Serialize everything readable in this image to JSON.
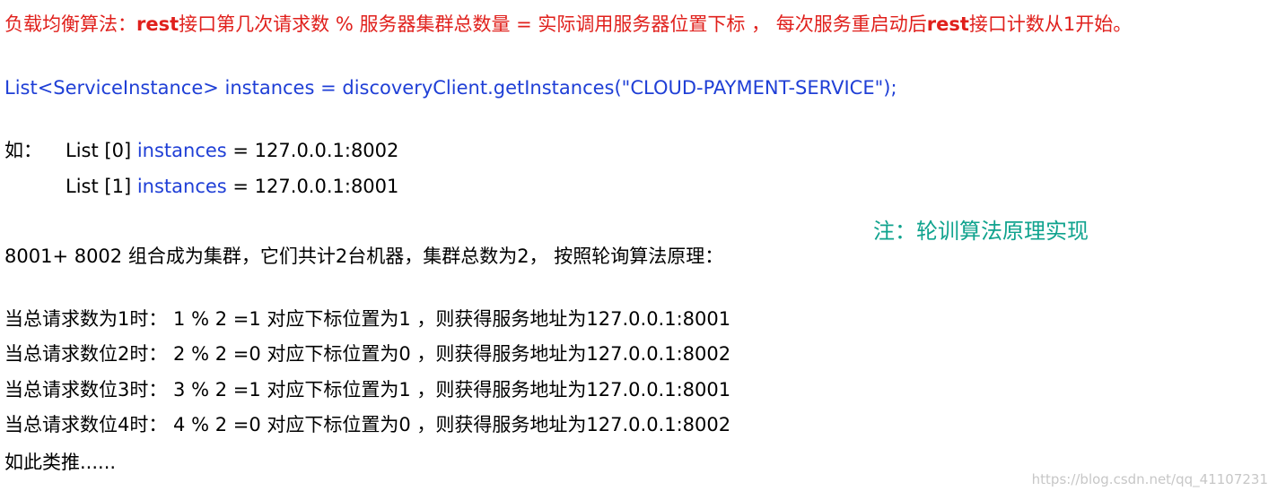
{
  "heading": {
    "part1": "负载均衡算法：",
    "rest": "rest",
    "part2": "接口第几次请求数 % 服务器集群总数量 = 实际调用服务器位置下标 ， 每次服务重启动后",
    "rest2": "rest",
    "part3": "接口计数从1开始。"
  },
  "code_line": "List<ServiceInstance> instances = discoveryClient.getInstances(\"CLOUD-PAYMENT-SERVICE\");",
  "example": {
    "prefix": "如：",
    "items": [
      {
        "list": "List [0]",
        "word": "instances",
        "rest": " = 127.0.0.1:8002"
      },
      {
        "list": "List [1]",
        "word": "instances",
        "rest": " = 127.0.0.1:8001"
      }
    ]
  },
  "cluster_line": "8001+ 8002 组合成为集群，它们共计2台机器，集群总数为2， 按照轮询算法原理：",
  "note": "注：轮训算法原理实现",
  "requests": [
    "当总请求数为1时： 1 % 2 =1 对应下标位置为1 ，则获得服务地址为127.0.0.1:8001",
    "当总请求数位2时： 2 % 2 =0 对应下标位置为0 ，则获得服务地址为127.0.0.1:8002",
    "当总请求数位3时： 3 % 2 =1 对应下标位置为1 ，则获得服务地址为127.0.0.1:8001",
    "当总请求数位4时： 4 % 2 =0 对应下标位置为0 ，则获得服务地址为127.0.0.1:8002"
  ],
  "ending": "如此类推......",
  "watermark": "https://blog.csdn.net/qq_41107231"
}
